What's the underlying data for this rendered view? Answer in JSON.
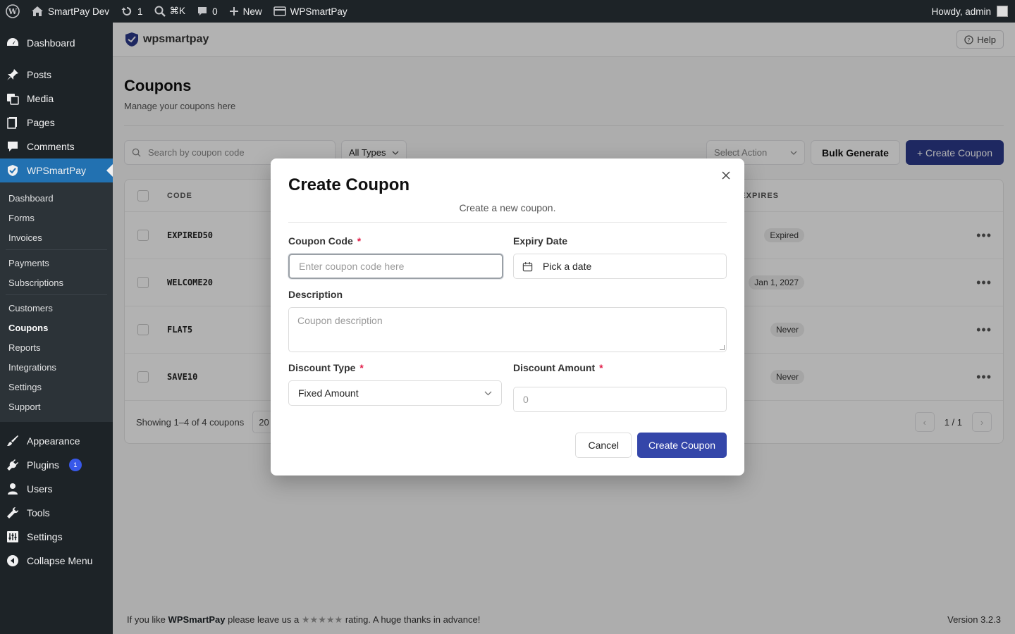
{
  "adminbar": {
    "site_name": "SmartPay Dev",
    "updates_count": "1",
    "search_shortcut": "⌘K",
    "comments_count": "0",
    "new_label": "New",
    "plugin_label": "WPSmartPay",
    "howdy": "Howdy, admin"
  },
  "sidebar": {
    "dashboard": "Dashboard",
    "posts": "Posts",
    "media": "Media",
    "pages": "Pages",
    "comments": "Comments",
    "wpsmartpay": "WPSmartPay",
    "sub": [
      "Dashboard",
      "Forms",
      "Invoices",
      "Payments",
      "Subscriptions",
      "Customers",
      "Coupons",
      "Reports",
      "Integrations",
      "Settings",
      "Support"
    ],
    "appearance": "Appearance",
    "plugins": "Plugins",
    "plugins_badge": "1",
    "users": "Users",
    "tools": "Tools",
    "settings": "Settings",
    "collapse": "Collapse Menu"
  },
  "topbar": {
    "logo": "wpsmartpay",
    "help": "Help"
  },
  "page": {
    "title": "Coupons",
    "subtitle": "Manage your coupons here",
    "search_placeholder": "Search by coupon code",
    "type_filter": "All Types",
    "select_action": "Select Action",
    "bulk_generate": "Bulk Generate",
    "create_coupon": "+ Create Coupon"
  },
  "table": {
    "col_code": "CODE",
    "col_expires": "EXPIRES",
    "rows": [
      {
        "code": "EXPIRED50",
        "expires": "Expired"
      },
      {
        "code": "WELCOME20",
        "expires": "Jan 1, 2027"
      },
      {
        "code": "FLAT5",
        "expires": "Never"
      },
      {
        "code": "SAVE10",
        "expires": "Never"
      }
    ],
    "showing": "Showing 1–4 of 4 coupons",
    "per_page": "20",
    "page_indicator": "1 / 1"
  },
  "footer": {
    "prefix": "If you like",
    "brand": "WPSmartPay",
    "middle": "please leave us a",
    "stars": "★★★★★",
    "suffix": "rating. A huge thanks in advance!",
    "version": "Version 3.2.3"
  },
  "modal": {
    "title": "Create Coupon",
    "subtitle": "Create a new coupon.",
    "code_label": "Coupon Code",
    "code_placeholder": "Enter coupon code here",
    "expiry_label": "Expiry Date",
    "expiry_placeholder": "Pick a date",
    "desc_label": "Description",
    "desc_placeholder": "Coupon description",
    "type_label": "Discount Type",
    "type_value": "Fixed Amount",
    "amount_label": "Discount Amount",
    "amount_placeholder": "0",
    "cancel": "Cancel",
    "create": "Create Coupon",
    "required_mark": "*"
  }
}
